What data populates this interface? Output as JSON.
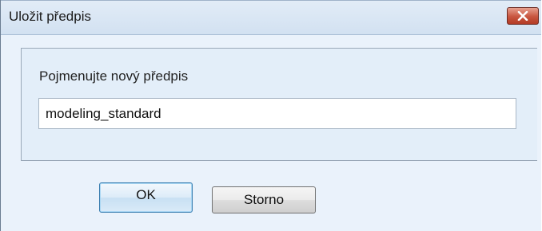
{
  "window": {
    "title": "Uložit předpis",
    "close_icon": "close-icon"
  },
  "form": {
    "prompt_label": "Pojmenujte nový předpis",
    "name_value": "modeling_standard",
    "name_placeholder": ""
  },
  "buttons": {
    "ok_label": "OK",
    "cancel_label": "Storno"
  },
  "colors": {
    "close_button": "#c8553f",
    "ok_button_border": "#3c7fb1",
    "panel_background": "#e3eef9"
  }
}
